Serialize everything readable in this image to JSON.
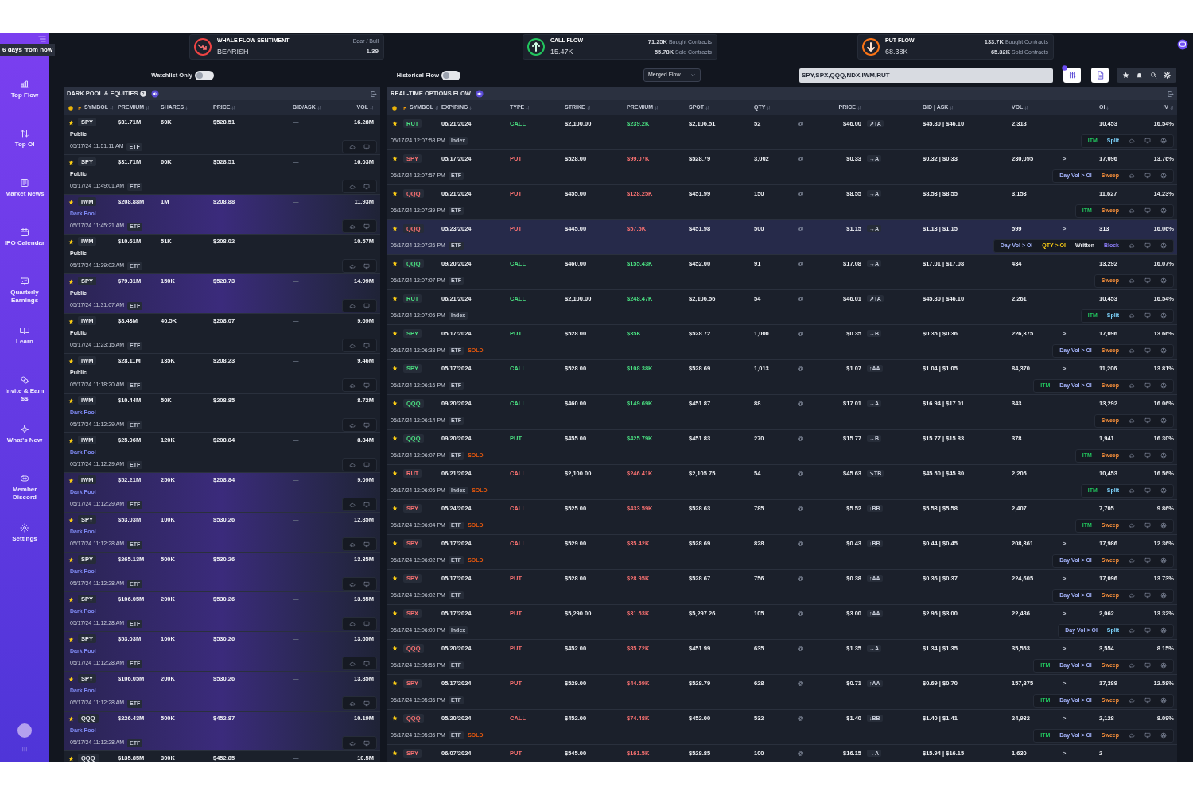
{
  "sidebar": {
    "tooltip": "6 days from now",
    "items": [
      {
        "label": "Top Flow"
      },
      {
        "label": "Top OI"
      },
      {
        "label": "Market News"
      },
      {
        "label": "IPO Calendar"
      },
      {
        "label": "Quarterly Earnings"
      },
      {
        "label": "Learn"
      },
      {
        "label": "Invite & Earn $$"
      },
      {
        "label": "What's New"
      },
      {
        "label": "Member Discord"
      },
      {
        "label": "Settings"
      }
    ]
  },
  "sentiment_card": {
    "title": "WHALE FLOW SENTIMENT",
    "value": "BEARISH",
    "ratio_label": "Bear / Bull",
    "ratio": "1.39"
  },
  "call_flow": {
    "title": "CALL FLOW",
    "value": "15.47K",
    "bought": "71.25K",
    "bought_label": "Bought Contracts",
    "sold": "55.78K",
    "sold_label": "Sold Contracts"
  },
  "put_flow": {
    "title": "PUT FLOW",
    "value": "68.38K",
    "bought": "133.7K",
    "bought_label": "Bought Contracts",
    "sold": "65.32K",
    "sold_label": "Sold Contracts"
  },
  "controls": {
    "watchlist": {
      "label": "Watchlist Only",
      "on": false
    },
    "historical": {
      "label": "Historical Flow",
      "on": false
    },
    "flow_mode": {
      "value": "Merged Flow"
    },
    "search": {
      "value": "SPY,SPX,QQQ,NDX,IWM,RUT"
    }
  },
  "dark_pool": {
    "title": "DARK POOL & EQUITIES",
    "columns": [
      "SYMBOL",
      "PREMIUM",
      "SHARES",
      "PRICE",
      "BID/ASK",
      "VOL"
    ],
    "rows": [
      {
        "symbol": "SPY",
        "premium": "$31.71M",
        "shares": "60K",
        "price": "$528.51",
        "bid_ask": "—",
        "vol": "16.28M",
        "venue": "Public",
        "dark_pool": false,
        "time": "05/17/24 11:51:11 AM",
        "asset": "ETF",
        "highlighted": false
      },
      {
        "symbol": "SPY",
        "premium": "$31.71M",
        "shares": "60K",
        "price": "$528.51",
        "bid_ask": "—",
        "vol": "16.03M",
        "venue": "Public",
        "dark_pool": false,
        "time": "05/17/24 11:49:01 AM",
        "asset": "ETF",
        "highlighted": false
      },
      {
        "symbol": "IWM",
        "premium": "$208.88M",
        "shares": "1M",
        "price": "$208.88",
        "bid_ask": "—",
        "vol": "11.93M",
        "venue": "Dark Pool",
        "dark_pool": true,
        "time": "05/17/24 11:45:21 AM",
        "asset": "ETF",
        "highlighted": true
      },
      {
        "symbol": "IWM",
        "premium": "$10.61M",
        "shares": "51K",
        "price": "$208.02",
        "bid_ask": "—",
        "vol": "10.57M",
        "venue": "Public",
        "dark_pool": false,
        "time": "05/17/24 11:39:02 AM",
        "asset": "ETF",
        "highlighted": false
      },
      {
        "symbol": "SPY",
        "premium": "$79.31M",
        "shares": "150K",
        "price": "$528.73",
        "bid_ask": "—",
        "vol": "14.99M",
        "venue": "Public",
        "dark_pool": false,
        "time": "05/17/24 11:31:07 AM",
        "asset": "ETF",
        "highlighted": true
      },
      {
        "symbol": "IWM",
        "premium": "$8.43M",
        "shares": "40.5K",
        "price": "$208.07",
        "bid_ask": "—",
        "vol": "9.69M",
        "venue": "Public",
        "dark_pool": false,
        "time": "05/17/24 11:23:15 AM",
        "asset": "ETF",
        "highlighted": false
      },
      {
        "symbol": "IWM",
        "premium": "$28.11M",
        "shares": "135K",
        "price": "$208.23",
        "bid_ask": "—",
        "vol": "9.46M",
        "venue": "Public",
        "dark_pool": false,
        "time": "05/17/24 11:18:20 AM",
        "asset": "ETF",
        "highlighted": false
      },
      {
        "symbol": "IWM",
        "premium": "$10.44M",
        "shares": "50K",
        "price": "$208.85",
        "bid_ask": "—",
        "vol": "8.72M",
        "venue": "Dark Pool",
        "dark_pool": true,
        "time": "05/17/24 11:12:29 AM",
        "asset": "ETF",
        "highlighted": false
      },
      {
        "symbol": "IWM",
        "premium": "$25.06M",
        "shares": "120K",
        "price": "$208.84",
        "bid_ask": "—",
        "vol": "8.84M",
        "venue": "Dark Pool",
        "dark_pool": true,
        "time": "05/17/24 11:12:29 AM",
        "asset": "ETF",
        "highlighted": false
      },
      {
        "symbol": "IWM",
        "premium": "$52.21M",
        "shares": "250K",
        "price": "$208.84",
        "bid_ask": "—",
        "vol": "9.09M",
        "venue": "Dark Pool",
        "dark_pool": true,
        "time": "05/17/24 11:12:29 AM",
        "asset": "ETF",
        "highlighted": true
      },
      {
        "symbol": "SPY",
        "premium": "$53.03M",
        "shares": "100K",
        "price": "$530.26",
        "bid_ask": "—",
        "vol": "12.85M",
        "venue": "Dark Pool",
        "dark_pool": true,
        "time": "05/17/24 11:12:28 AM",
        "asset": "ETF",
        "highlighted": true
      },
      {
        "symbol": "SPY",
        "premium": "$265.13M",
        "shares": "500K",
        "price": "$530.26",
        "bid_ask": "—",
        "vol": "13.35M",
        "venue": "Dark Pool",
        "dark_pool": true,
        "time": "05/17/24 11:12:28 AM",
        "asset": "ETF",
        "highlighted": true
      },
      {
        "symbol": "SPY",
        "premium": "$106.05M",
        "shares": "200K",
        "price": "$530.26",
        "bid_ask": "—",
        "vol": "13.55M",
        "venue": "Dark Pool",
        "dark_pool": true,
        "time": "05/17/24 11:12:28 AM",
        "asset": "ETF",
        "highlighted": true
      },
      {
        "symbol": "SPY",
        "premium": "$53.03M",
        "shares": "100K",
        "price": "$530.26",
        "bid_ask": "—",
        "vol": "13.65M",
        "venue": "Dark Pool",
        "dark_pool": true,
        "time": "05/17/24 11:12:28 AM",
        "asset": "ETF",
        "highlighted": true
      },
      {
        "symbol": "SPY",
        "premium": "$106.05M",
        "shares": "200K",
        "price": "$530.26",
        "bid_ask": "—",
        "vol": "13.85M",
        "venue": "Dark Pool",
        "dark_pool": true,
        "time": "05/17/24 11:12:28 AM",
        "asset": "ETF",
        "highlighted": true
      },
      {
        "symbol": "QQQ",
        "premium": "$226.43M",
        "shares": "500K",
        "price": "$452.87",
        "bid_ask": "—",
        "vol": "10.19M",
        "venue": "Dark Pool",
        "dark_pool": true,
        "time": "05/17/24 11:12:28 AM",
        "asset": "ETF",
        "highlighted": true
      },
      {
        "symbol": "QQQ",
        "premium": "$135.85M",
        "shares": "300K",
        "price": "$452.85",
        "bid_ask": "—",
        "vol": "10.5M",
        "highlighted": false
      }
    ]
  },
  "options_flow": {
    "title": "REAL-TIME OPTIONS FLOW",
    "columns": [
      "SYMBOL",
      "EXPIRING",
      "TYPE",
      "STRIKE",
      "PREMIUM",
      "SPOT",
      "QTY",
      "PRICE",
      "BID | ASK",
      "VOL",
      "OI",
      "IV"
    ],
    "rows": [
      {
        "symbol": "RUT",
        "expiring": "06/21/2024",
        "type": "CALL",
        "strike": "$2,100.00",
        "premium": "$239.2K",
        "spot": "$2,106.51",
        "qty": "52",
        "at": "@",
        "price": "$46.00",
        "side": "↗TA",
        "bid_ask": "$45.80 | $46.10",
        "vol": "2,318",
        "oi": "10,453",
        "iv": "16.54%",
        "bullish": true,
        "highlighted": false,
        "time": "05/17/24 12:07:58 PM",
        "asset": "Index",
        "tags": [
          {
            "label": "ITM",
            "kind": "itm"
          },
          {
            "label": "Split",
            "kind": "split"
          }
        ]
      },
      {
        "symbol": "SPY",
        "expiring": "05/17/2024",
        "type": "PUT",
        "strike": "$528.00",
        "premium": "$99.07K",
        "spot": "$528.79",
        "qty": "3,002",
        "at": "@",
        "price": "$0.33",
        "side": "→A",
        "bid_ask": "$0.32 | $0.33",
        "vol": "230,095",
        "vol_flag": ">",
        "oi": "17,096",
        "iv": "13.76%",
        "bullish": false,
        "highlighted": false,
        "time": "05/17/24 12:07:57 PM",
        "asset": "ETF",
        "tags": [
          {
            "label": "Day Vol > OI",
            "kind": "dayvol"
          },
          {
            "label": "Sweep",
            "kind": "sweep"
          }
        ]
      },
      {
        "symbol": "QQQ",
        "expiring": "06/21/2024",
        "type": "PUT",
        "strike": "$455.00",
        "premium": "$128.25K",
        "spot": "$451.99",
        "qty": "150",
        "at": "@",
        "price": "$8.55",
        "side": "→A",
        "bid_ask": "$8.53 | $8.55",
        "vol": "3,153",
        "oi": "11,627",
        "iv": "14.23%",
        "bullish": false,
        "highlighted": false,
        "time": "05/17/24 12:07:39 PM",
        "asset": "ETF",
        "tags": [
          {
            "label": "ITM",
            "kind": "itm"
          },
          {
            "label": "Sweep",
            "kind": "sweep"
          }
        ]
      },
      {
        "symbol": "QQQ",
        "expiring": "05/23/2024",
        "type": "PUT",
        "strike": "$445.00",
        "premium": "$57.5K",
        "spot": "$451.98",
        "qty": "500",
        "at": "@",
        "price": "$1.15",
        "side": "→A",
        "bid_ask": "$1.13 | $1.15",
        "vol": "599",
        "vol_flag": ">",
        "oi": "313",
        "iv": "16.06%",
        "bullish": false,
        "highlighted": true,
        "time": "05/17/24 12:07:26 PM",
        "asset": "ETF",
        "tags": [
          {
            "label": "Day Vol > OI",
            "kind": "dayvol"
          },
          {
            "label": "QTY > OI",
            "kind": "qtyoi"
          },
          {
            "label": "Written",
            "kind": "written"
          },
          {
            "label": "Block",
            "kind": "block"
          }
        ]
      },
      {
        "symbol": "QQQ",
        "expiring": "09/20/2024",
        "type": "CALL",
        "strike": "$460.00",
        "premium": "$155.43K",
        "spot": "$452.00",
        "qty": "91",
        "at": "@",
        "price": "$17.08",
        "side": "→A",
        "bid_ask": "$17.01 | $17.08",
        "vol": "434",
        "oi": "13,292",
        "iv": "16.07%",
        "bullish": true,
        "highlighted": false,
        "time": "05/17/24 12:07:07 PM",
        "asset": "ETF",
        "tags": [
          {
            "label": "Sweep",
            "kind": "sweep"
          }
        ]
      },
      {
        "symbol": "RUT",
        "expiring": "06/21/2024",
        "type": "CALL",
        "strike": "$2,100.00",
        "premium": "$248.47K",
        "spot": "$2,106.56",
        "qty": "54",
        "at": "@",
        "price": "$46.01",
        "side": "↗TA",
        "bid_ask": "$45.80 | $46.10",
        "vol": "2,261",
        "oi": "10,453",
        "iv": "16.54%",
        "bullish": true,
        "highlighted": false,
        "time": "05/17/24 12:07:05 PM",
        "asset": "Index",
        "tags": [
          {
            "label": "ITM",
            "kind": "itm"
          },
          {
            "label": "Split",
            "kind": "split"
          }
        ]
      },
      {
        "symbol": "SPY",
        "expiring": "05/17/2024",
        "type": "PUT",
        "strike": "$528.00",
        "premium": "$35K",
        "spot": "$528.72",
        "qty": "1,000",
        "at": "@",
        "price": "$0.35",
        "side": "→B",
        "bid_ask": "$0.35 | $0.36",
        "vol": "226,375",
        "vol_flag": ">",
        "oi": "17,096",
        "iv": "13.66%",
        "bullish": true,
        "highlighted": false,
        "time": "05/17/24 12:06:33 PM",
        "asset": "ETF",
        "flag": "SOLD",
        "tags": [
          {
            "label": "Day Vol > OI",
            "kind": "dayvol"
          },
          {
            "label": "Sweep",
            "kind": "sweep"
          }
        ]
      },
      {
        "symbol": "SPY",
        "expiring": "05/17/2024",
        "type": "CALL",
        "strike": "$528.00",
        "premium": "$108.38K",
        "spot": "$528.69",
        "qty": "1,013",
        "at": "@",
        "price": "$1.07",
        "side": "↑AA",
        "bid_ask": "$1.04 | $1.05",
        "vol": "84,370",
        "vol_flag": ">",
        "oi": "11,206",
        "iv": "13.81%",
        "bullish": true,
        "highlighted": false,
        "time": "05/17/24 12:06:16 PM",
        "asset": "ETF",
        "tags": [
          {
            "label": "ITM",
            "kind": "itm"
          },
          {
            "label": "Day Vol > OI",
            "kind": "dayvol"
          },
          {
            "label": "Sweep",
            "kind": "sweep"
          }
        ]
      },
      {
        "symbol": "QQQ",
        "expiring": "09/20/2024",
        "type": "CALL",
        "strike": "$460.00",
        "premium": "$149.69K",
        "spot": "$451.87",
        "qty": "88",
        "at": "@",
        "price": "$17.01",
        "side": "→A",
        "bid_ask": "$16.94 | $17.01",
        "vol": "343",
        "oi": "13,292",
        "iv": "16.06%",
        "bullish": true,
        "highlighted": false,
        "time": "05/17/24 12:06:14 PM",
        "asset": "ETF",
        "tags": [
          {
            "label": "Sweep",
            "kind": "sweep"
          }
        ]
      },
      {
        "symbol": "QQQ",
        "expiring": "09/20/2024",
        "type": "PUT",
        "strike": "$455.00",
        "premium": "$425.79K",
        "spot": "$451.83",
        "qty": "270",
        "at": "@",
        "price": "$15.77",
        "side": "→B",
        "bid_ask": "$15.77 | $15.83",
        "vol": "378",
        "oi": "1,941",
        "iv": "16.30%",
        "bullish": true,
        "highlighted": false,
        "time": "05/17/24 12:06:07 PM",
        "asset": "ETF",
        "flag": "SOLD",
        "tags": [
          {
            "label": "ITM",
            "kind": "itm"
          },
          {
            "label": "Sweep",
            "kind": "sweep"
          }
        ]
      },
      {
        "symbol": "RUT",
        "expiring": "06/21/2024",
        "type": "CALL",
        "strike": "$2,100.00",
        "premium": "$246.41K",
        "spot": "$2,105.75",
        "qty": "54",
        "at": "@",
        "price": "$45.63",
        "side": "↘TB",
        "bid_ask": "$45.50 | $45.80",
        "vol": "2,205",
        "oi": "10,453",
        "iv": "16.56%",
        "bullish": false,
        "highlighted": false,
        "time": "05/17/24 12:06:05 PM",
        "asset": "Index",
        "flag": "SOLD",
        "tags": [
          {
            "label": "ITM",
            "kind": "itm"
          },
          {
            "label": "Split",
            "kind": "split"
          }
        ]
      },
      {
        "symbol": "SPY",
        "expiring": "05/24/2024",
        "type": "CALL",
        "strike": "$525.00",
        "premium": "$433.59K",
        "spot": "$528.63",
        "qty": "785",
        "at": "@",
        "price": "$5.52",
        "side": "↓BB",
        "bid_ask": "$5.53 | $5.58",
        "vol": "2,407",
        "oi": "7,705",
        "iv": "9.86%",
        "bullish": false,
        "highlighted": false,
        "time": "05/17/24 12:06:04 PM",
        "asset": "ETF",
        "flag": "SOLD",
        "tags": [
          {
            "label": "ITM",
            "kind": "itm"
          },
          {
            "label": "Sweep",
            "kind": "sweep"
          }
        ]
      },
      {
        "symbol": "SPY",
        "expiring": "05/17/2024",
        "type": "CALL",
        "strike": "$529.00",
        "premium": "$35.42K",
        "spot": "$528.69",
        "qty": "828",
        "at": "@",
        "price": "$0.43",
        "side": "↓BB",
        "bid_ask": "$0.44 | $0.45",
        "vol": "208,361",
        "vol_flag": ">",
        "oi": "17,986",
        "iv": "12.36%",
        "bullish": false,
        "highlighted": false,
        "time": "05/17/24 12:06:02 PM",
        "asset": "ETF",
        "flag": "SOLD",
        "tags": [
          {
            "label": "Day Vol > OI",
            "kind": "dayvol"
          },
          {
            "label": "Sweep",
            "kind": "sweep"
          }
        ]
      },
      {
        "symbol": "SPY",
        "expiring": "05/17/2024",
        "type": "PUT",
        "strike": "$528.00",
        "premium": "$28.95K",
        "spot": "$528.67",
        "qty": "756",
        "at": "@",
        "price": "$0.38",
        "side": "↑AA",
        "bid_ask": "$0.36 | $0.37",
        "vol": "224,605",
        "vol_flag": ">",
        "oi": "17,096",
        "iv": "13.73%",
        "bullish": false,
        "highlighted": false,
        "time": "05/17/24 12:06:02 PM",
        "asset": "ETF",
        "tags": [
          {
            "label": "Day Vol > OI",
            "kind": "dayvol"
          },
          {
            "label": "Sweep",
            "kind": "sweep"
          }
        ]
      },
      {
        "symbol": "SPX",
        "expiring": "05/17/2024",
        "type": "PUT",
        "strike": "$5,290.00",
        "premium": "$31.53K",
        "spot": "$5,297.26",
        "qty": "105",
        "at": "@",
        "price": "$3.00",
        "side": "↑AA",
        "bid_ask": "$2.95 | $3.00",
        "vol": "22,486",
        "vol_flag": ">",
        "oi": "2,062",
        "iv": "13.32%",
        "bullish": false,
        "highlighted": false,
        "time": "05/17/24 12:06:00 PM",
        "asset": "Index",
        "tags": [
          {
            "label": "Day Vol > OI",
            "kind": "dayvol"
          },
          {
            "label": "Split",
            "kind": "split"
          }
        ]
      },
      {
        "symbol": "QQQ",
        "expiring": "05/20/2024",
        "type": "PUT",
        "strike": "$452.00",
        "premium": "$85.72K",
        "spot": "$451.99",
        "qty": "635",
        "at": "@",
        "price": "$1.35",
        "side": "→A",
        "bid_ask": "$1.34 | $1.35",
        "vol": "35,553",
        "vol_flag": ">",
        "oi": "3,554",
        "iv": "8.15%",
        "bullish": false,
        "highlighted": false,
        "time": "05/17/24 12:05:55 PM",
        "asset": "ETF",
        "tags": [
          {
            "label": "ITM",
            "kind": "itm"
          },
          {
            "label": "Day Vol > OI",
            "kind": "dayvol"
          },
          {
            "label": "Sweep",
            "kind": "sweep"
          }
        ]
      },
      {
        "symbol": "SPY",
        "expiring": "05/17/2024",
        "type": "PUT",
        "strike": "$529.00",
        "premium": "$44.59K",
        "spot": "$528.79",
        "qty": "628",
        "at": "@",
        "price": "$0.71",
        "side": "↑AA",
        "bid_ask": "$0.69 | $0.70",
        "vol": "157,875",
        "vol_flag": ">",
        "oi": "17,389",
        "iv": "12.58%",
        "bullish": false,
        "highlighted": false,
        "time": "05/17/24 12:05:36 PM",
        "asset": "ETF",
        "tags": [
          {
            "label": "ITM",
            "kind": "itm"
          },
          {
            "label": "Day Vol > OI",
            "kind": "dayvol"
          },
          {
            "label": "Sweep",
            "kind": "sweep"
          }
        ]
      },
      {
        "symbol": "QQQ",
        "expiring": "05/20/2024",
        "type": "CALL",
        "strike": "$452.00",
        "premium": "$74.48K",
        "spot": "$452.00",
        "qty": "532",
        "at": "@",
        "price": "$1.40",
        "side": "↓BB",
        "bid_ask": "$1.40 | $1.41",
        "vol": "24,932",
        "vol_flag": ">",
        "oi": "2,128",
        "iv": "8.09%",
        "bullish": false,
        "highlighted": false,
        "time": "05/17/24 12:05:35 PM",
        "asset": "ETF",
        "flag": "SOLD",
        "tags": [
          {
            "label": "ITM",
            "kind": "itm"
          },
          {
            "label": "Day Vol > OI",
            "kind": "dayvol"
          },
          {
            "label": "Sweep",
            "kind": "sweep"
          }
        ]
      },
      {
        "symbol": "SPY",
        "expiring": "06/07/2024",
        "type": "PUT",
        "strike": "$545.00",
        "premium": "$161.5K",
        "spot": "$528.85",
        "qty": "100",
        "at": "@",
        "price": "$16.15",
        "side": "→A",
        "bid_ask": "$15.94 | $16.15",
        "vol": "1,630",
        "vol_flag": ">",
        "oi": "2",
        "bullish": false,
        "highlighted": false
      }
    ]
  }
}
